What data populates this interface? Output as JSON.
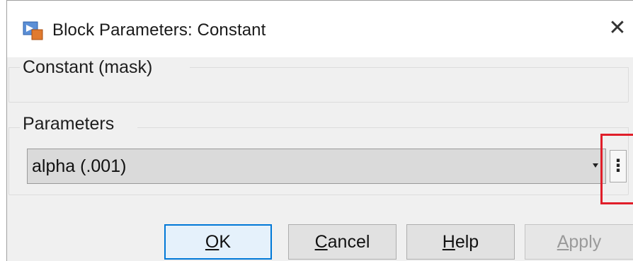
{
  "window": {
    "title": "Block Parameters: Constant",
    "close_glyph": "✕"
  },
  "mask_group": {
    "label": "Constant (mask)"
  },
  "parameters_group": {
    "label": "Parameters",
    "value": "alpha (.001)",
    "menu_glyph": "⋮"
  },
  "buttons": {
    "ok": {
      "mnemonic": "O",
      "rest": "K"
    },
    "cancel": {
      "mnemonic": "C",
      "rest": "ancel"
    },
    "help": {
      "mnemonic": "H",
      "rest": "elp"
    },
    "apply": {
      "mnemonic": "A",
      "rest": "pply"
    }
  },
  "colors": {
    "highlight": "#e01e2a",
    "focus": "#0078d7"
  },
  "icons": [
    "simulink-block-icon",
    "close-icon",
    "dropdown-arrow-icon",
    "vertical-ellipsis-icon"
  ]
}
